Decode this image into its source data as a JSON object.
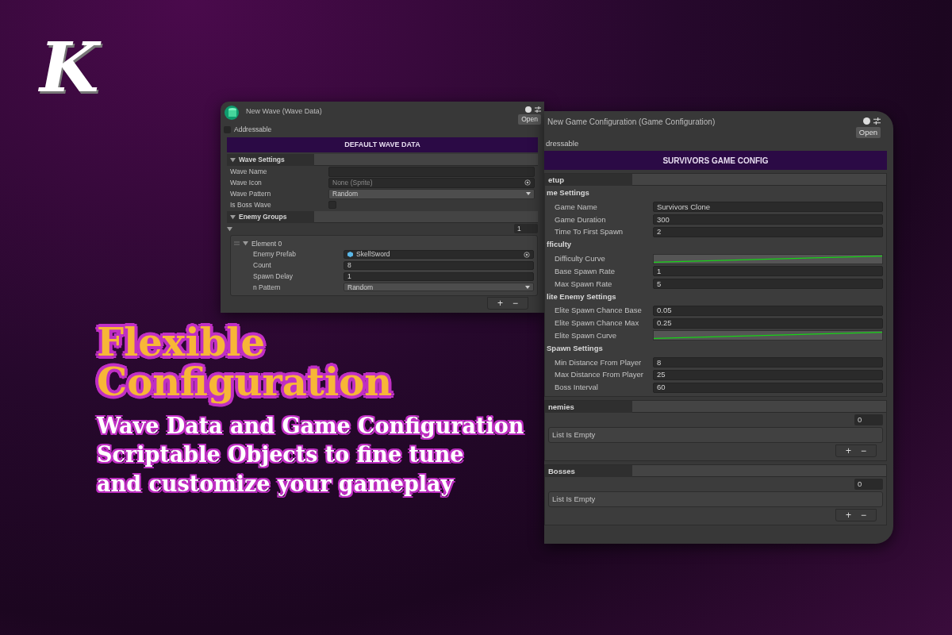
{
  "logo": {
    "letter": "K"
  },
  "wave_window": {
    "title": "New Wave (Wave Data)",
    "open_button": "Open",
    "addressable": {
      "label": "Addressable",
      "checked": false
    },
    "banner": "DEFAULT WAVE DATA",
    "settings": {
      "header": "Wave Settings",
      "fields": [
        {
          "kind": "text",
          "label": "Wave Name"
        },
        {
          "kind": "object",
          "label": "Wave Icon",
          "placeholder": "None (Sprite)"
        },
        {
          "kind": "dropdown",
          "label": "Wave Pattern",
          "value": "Random"
        },
        {
          "kind": "checkbox",
          "label": "Is Boss Wave",
          "checked": false
        }
      ]
    },
    "groups": {
      "header": "Enemy Groups",
      "count": "1",
      "expanded": true,
      "elements": [
        {
          "title": "Element 0",
          "expanded": true,
          "fields": [
            {
              "kind": "object",
              "label": "Enemy Prefab",
              "value": "SkellSword"
            },
            {
              "kind": "text",
              "label": "Count",
              "value": "8"
            },
            {
              "kind": "text",
              "label": "Spawn Delay",
              "value": "1"
            },
            {
              "kind": "dropdown",
              "label": "n Pattern",
              "value": "Random"
            }
          ]
        }
      ],
      "add": "+",
      "remove": "−"
    }
  },
  "config_window": {
    "title": "New Game Configuration (Game Configuration)",
    "open_button": "Open",
    "addressable": "dressable",
    "banner": "SURVIVORS GAME CONFIG",
    "setup": {
      "header": "etup",
      "groups": [
        {
          "title": "me Settings",
          "fields": [
            {
              "kind": "text",
              "label": "Game Name",
              "value": "Survivors Clone"
            },
            {
              "kind": "text",
              "label": "Game Duration",
              "value": "300"
            },
            {
              "kind": "text",
              "label": "Time To First Spawn",
              "value": "2"
            }
          ]
        },
        {
          "title": "fficulty",
          "fields": [
            {
              "kind": "curve",
              "label": "Difficulty Curve"
            },
            {
              "kind": "text",
              "label": "Base Spawn Rate",
              "value": "1"
            },
            {
              "kind": "text",
              "label": "Max Spawn Rate",
              "value": "5"
            }
          ]
        },
        {
          "title": "lite Enemy Settings",
          "fields": [
            {
              "kind": "text",
              "label": "Elite Spawn Chance Base",
              "value": "0.05"
            },
            {
              "kind": "text",
              "label": "Elite Spawn Chance Max",
              "value": "0.25"
            },
            {
              "kind": "curve",
              "label": "Elite Spawn Curve"
            }
          ]
        },
        {
          "title": "Spawn Settings",
          "fields": [
            {
              "kind": "text",
              "label": "Min Distance From Player",
              "value": "8"
            },
            {
              "kind": "text",
              "label": "Max Distance From Player",
              "value": "25"
            },
            {
              "kind": "text",
              "label": "Boss Interval",
              "value": "60"
            }
          ]
        }
      ]
    },
    "lists": [
      {
        "header": "nemies",
        "count": "0",
        "empty_text": "List Is Empty",
        "add": "+",
        "remove": "−"
      },
      {
        "header": "Bosses",
        "count": "0",
        "empty_text": "List Is Empty",
        "add": "+",
        "remove": "−"
      }
    ]
  },
  "headline": [
    "Flexible",
    "Configuration"
  ],
  "subtitle": [
    "Wave Data and Game Configuration",
    "Scriptable Objects to fine tune",
    "and customize your gameplay"
  ]
}
